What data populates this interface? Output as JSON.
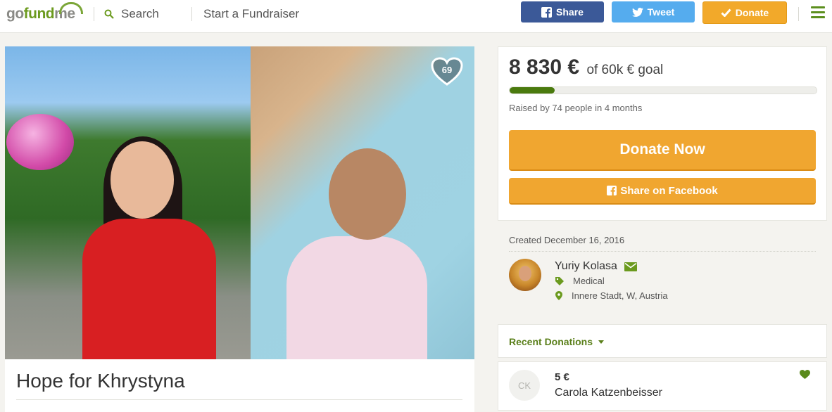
{
  "nav": {
    "logo_part1": "go",
    "logo_part2": "fund",
    "logo_part3": "me",
    "search_label": "Search",
    "start_label": "Start a Fundraiser",
    "share_label": "Share",
    "tweet_label": "Tweet",
    "donate_label": "Donate",
    "icons": [
      "search-icon",
      "facebook-icon",
      "twitter-icon",
      "check-icon",
      "menu-icon"
    ],
    "colors": {
      "facebook": "#3b5998",
      "twitter": "#55acee",
      "donate": "#f2a92a",
      "brand_green": "#6b9a1e"
    }
  },
  "campaign": {
    "title": "Hope for Khrystyna",
    "hearts_count": "69"
  },
  "donation_box": {
    "raised_amount": "8 830 €",
    "goal_text": "of 60k € goal",
    "progress_fraction": 0.147,
    "raised_by": "Raised by 74 people in 4 months",
    "donate_now_label": "Donate Now",
    "share_facebook_label": "Share on Facebook"
  },
  "info": {
    "created": "Created December 16, 2016",
    "organizer_name": "Yuriy Kolasa",
    "category": "Medical",
    "location": "Innere Stadt, W, Austria",
    "icons": [
      "envelope-icon",
      "tag-icon",
      "map-pin-icon"
    ]
  },
  "recent": {
    "title": "Recent Donations",
    "donations": [
      {
        "initials": "CK",
        "amount": "5 €",
        "name": "Carola Katzenbeisser"
      }
    ]
  }
}
